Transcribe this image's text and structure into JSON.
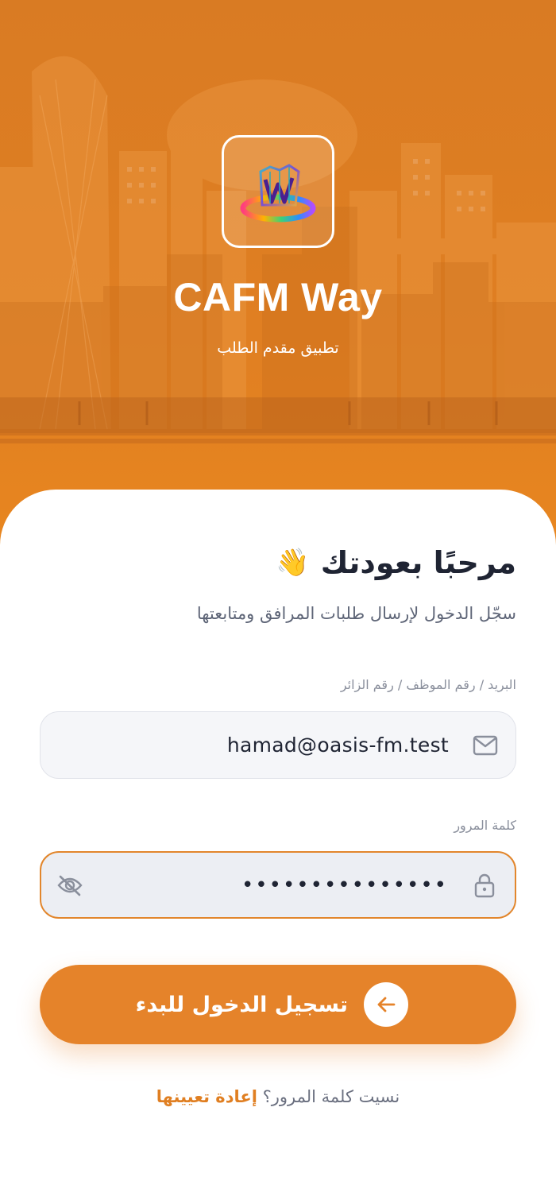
{
  "header": {
    "app_name": "CAFM Way",
    "subtitle": "تطبيق مقدم الطلب",
    "logo_icon": "cafm-way-logo-icon"
  },
  "login": {
    "welcome_title": "مرحبًا بعودتك",
    "welcome_emoji": "👋",
    "welcome_subtitle": "سجّل الدخول لإرسال طلبات المرافق ومتابعتها",
    "email_label": "البريد / رقم الموظف / رقم الزائر",
    "email_value": "hamad@oasis-fm.test",
    "email_icon": "mail-icon",
    "password_label": "كلمة المرور",
    "password_value": "•••••••••••••••",
    "password_icon": "lock-icon",
    "toggle_visibility_icon": "eye-off-icon",
    "submit_label": "تسجيل الدخول للبدء",
    "submit_icon": "arrow-left-icon",
    "forgot_text": "نسيت كلمة المرور؟",
    "reset_link": "إعادة تعيينها"
  },
  "colors": {
    "brand_orange": "#e5832a",
    "text_dark": "#1f2433",
    "text_muted": "#8a8f9c"
  }
}
